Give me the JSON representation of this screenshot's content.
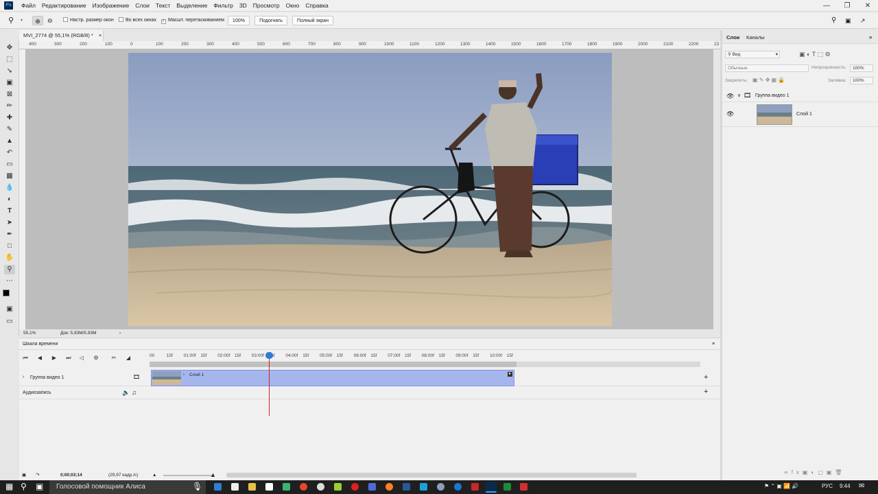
{
  "app": {
    "logo": "Ps",
    "menu": [
      "Файл",
      "Редактирование",
      "Изображение",
      "Слои",
      "Текст",
      "Выделение",
      "Фильтр",
      "3D",
      "Просмотр",
      "Окно",
      "Справка"
    ],
    "window_controls": [
      "minimize-icon",
      "restore-icon",
      "close-icon"
    ]
  },
  "options_bar": {
    "resize_windows_label": "Настр. размер окон",
    "resize_windows_checked": false,
    "all_windows_label": "Во всех окнах",
    "all_windows_checked": false,
    "scrubby_zoom_label": "Масшт. перетаскиванием",
    "scrubby_zoom_checked": true,
    "zoom_100": "100%",
    "fit_button": "Подогнать",
    "fullscreen_button": "Полный экран"
  },
  "document": {
    "tab_title": "MVI_2774 @ 55,1% (RGB/8) *",
    "zoom": "55,1%",
    "doc_size": "Док: 5,93M/5,93M",
    "ruler_labels": [
      "400",
      "300",
      "200",
      "100",
      "0",
      "100",
      "200",
      "300",
      "400",
      "500",
      "600",
      "700",
      "800",
      "900",
      "1000",
      "1100",
      "1200",
      "1300",
      "1400",
      "1500",
      "1600",
      "1700",
      "1800",
      "1900",
      "2000",
      "2100",
      "2200",
      "23"
    ]
  },
  "layers_panel": {
    "tabs": [
      "Слои",
      "Каналы"
    ],
    "filter_placeholder": "Вид",
    "blend_mode": "Обычные",
    "opacity_label": "Непрозрачность:",
    "opacity_value": "100%",
    "lock_label": "Закрепить:",
    "fill_label": "Заливка:",
    "fill_value": "100%",
    "group_name": "Группа видео 1",
    "layer_name": "Слой 1"
  },
  "timeline": {
    "title": "Шкала времени",
    "ruler": [
      "00",
      "15f",
      "01:00f",
      "15f",
      "02:00f",
      "15f",
      "03:00f",
      "15f",
      "04:00f",
      "15f",
      "05:00f",
      "15f",
      "06:00f",
      "15f",
      "07:00f",
      "15f",
      "08:00f",
      "15f",
      "09:00f",
      "15f",
      "10:00f",
      "15f"
    ],
    "video_track": "Группа видео 1",
    "clip_label": "Слой 1",
    "audio_track": "Аудиозапись",
    "timecode": "0;00;03;14",
    "fps": "(29,97 кадр./с)"
  },
  "taskbar": {
    "assistant": "Голосовой помощник Алиса",
    "lang": "РУС",
    "time": "9:44"
  },
  "colors": {
    "accent": "#31a8ff",
    "clip": "#a5b6ef",
    "playhead": "#d02020"
  }
}
